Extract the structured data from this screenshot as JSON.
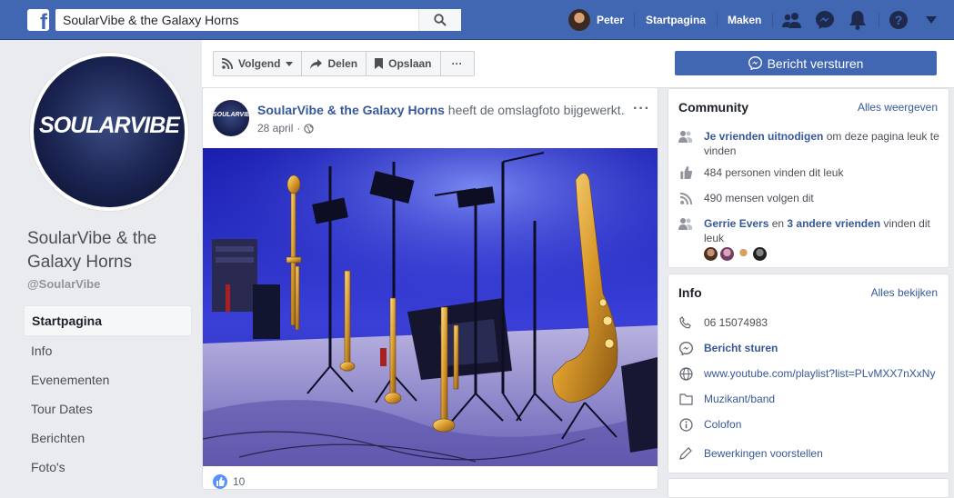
{
  "topbar": {
    "logo": "f",
    "search_value": "SoularVibe & the Galaxy Horns",
    "user_name": "Peter",
    "nav_home": "Startpagina",
    "nav_create": "Maken"
  },
  "page": {
    "name": "SoularVibe & the Galaxy Horns",
    "handle": "@SoularVibe",
    "logo_text": "SOULARVIBE"
  },
  "sidebar": {
    "items": [
      {
        "label": "Startpagina",
        "active": true
      },
      {
        "label": "Info"
      },
      {
        "label": "Evenementen"
      },
      {
        "label": "Tour Dates"
      },
      {
        "label": "Berichten"
      },
      {
        "label": "Foto's"
      }
    ]
  },
  "actions": {
    "follow": "Volgend",
    "share": "Delen",
    "save": "Opslaan",
    "more": "···",
    "message": "Bericht versturen"
  },
  "post": {
    "author": "SoularVibe & the Galaxy Horns",
    "action": " heeft de omslagfoto bijgewerkt.",
    "date": "28 april",
    "dot": "·",
    "more": "···",
    "like_count": "10",
    "avatar_text": "SOULARVIBE"
  },
  "community": {
    "title": "Community",
    "link": "Alles weergeven",
    "invite_link": "Je vrienden uitnodigen",
    "invite_rest": " om deze pagina leuk te vinden",
    "likes": "484 personen vinden dit leuk",
    "follows": "490 mensen volgen dit",
    "friend_name": "Gerrie Evers",
    "friend_and": " en ",
    "friend_others": "3 andere vrienden",
    "friend_rest": " vinden dit leuk"
  },
  "info": {
    "title": "Info",
    "link": "Alles bekijken",
    "phone": "06 15074983",
    "message": "Bericht sturen",
    "website": "www.youtube.com/playlist?list=PLvMXX7nXxNy",
    "category": "Muzikant/band",
    "colofon": "Colofon",
    "suggest": "Bewerkingen voorstellen"
  },
  "colors": {
    "brand_blue": "#4267b2",
    "link_blue": "#365899",
    "background": "#e9ebee"
  }
}
